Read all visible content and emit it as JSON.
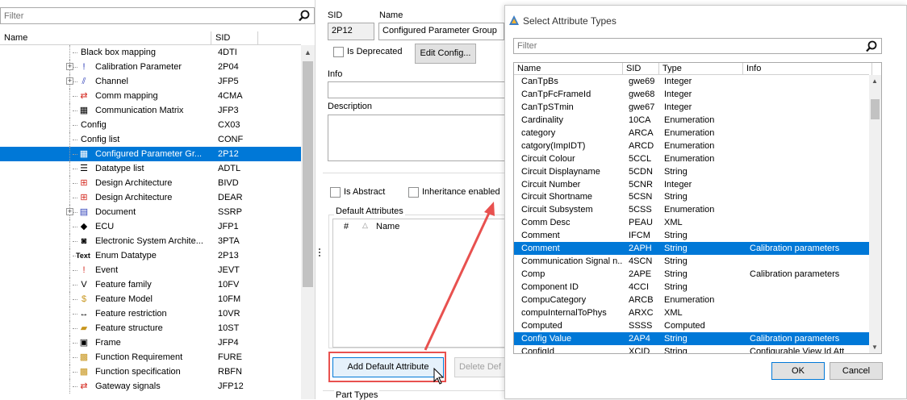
{
  "left_panel": {
    "filter_placeholder": "Filter",
    "columns": {
      "name": "Name",
      "sid": "SID"
    },
    "rows": [
      {
        "name": "Black box mapping",
        "sid": "4DTI",
        "icon": "dots-icon",
        "expand": false,
        "plain": true
      },
      {
        "name": "Calibration Parameter",
        "sid": "2P04",
        "icon": "exclamation-blue-icon",
        "expand": true
      },
      {
        "name": "Channel",
        "sid": "JFP5",
        "icon": "channel-icon",
        "expand": true
      },
      {
        "name": "Comm mapping",
        "sid": "4CMA",
        "icon": "red-arrows-icon",
        "expand": false
      },
      {
        "name": "Communication Matrix",
        "sid": "JFP3",
        "icon": "matrix-icon",
        "expand": false
      },
      {
        "name": "Config",
        "sid": "CX03",
        "icon": "none",
        "expand": false,
        "plain": true
      },
      {
        "name": "Config list",
        "sid": "CONF",
        "icon": "none",
        "expand": false,
        "plain": true
      },
      {
        "name": "Configured Parameter Gr...",
        "sid": "2P12",
        "icon": "parameter-group-icon",
        "expand": false,
        "selected": true
      },
      {
        "name": "Datatype list",
        "sid": "ADTL",
        "icon": "datatype-list-icon",
        "expand": false
      },
      {
        "name": "Design Architecture",
        "sid": "BIVD",
        "icon": "design-architecture-icon",
        "expand": false
      },
      {
        "name": "Design Architecture",
        "sid": "DEAR",
        "icon": "design-architecture-2-icon",
        "expand": false
      },
      {
        "name": "Document",
        "sid": "SSRP",
        "icon": "document-icon",
        "expand": true
      },
      {
        "name": "ECU",
        "sid": "JFP1",
        "icon": "ecu-icon",
        "expand": false
      },
      {
        "name": "Electronic System Archite...",
        "sid": "3PTA",
        "icon": "camera-icon",
        "expand": false
      },
      {
        "name": "Enum Datatype",
        "sid": "2P13",
        "icon": "text-icon",
        "expand": false
      },
      {
        "name": "Event",
        "sid": "JEVT",
        "icon": "exclamation-red-icon",
        "expand": false
      },
      {
        "name": "Feature family",
        "sid": "10FV",
        "icon": "feature-family-icon",
        "expand": false
      },
      {
        "name": "Feature Model",
        "sid": "10FM",
        "icon": "feature-model-icon",
        "expand": false
      },
      {
        "name": "Feature restriction",
        "sid": "10VR",
        "icon": "double-arrow-icon",
        "expand": false
      },
      {
        "name": "Feature structure",
        "sid": "10ST",
        "icon": "folder-open-icon",
        "expand": false
      },
      {
        "name": "Frame",
        "sid": "JFP4",
        "icon": "frame-icon",
        "expand": false
      },
      {
        "name": "Function Requirement",
        "sid": "FURE",
        "icon": "package-icon",
        "expand": false
      },
      {
        "name": "Function specification",
        "sid": "RBFN",
        "icon": "package-2-icon",
        "expand": false
      },
      {
        "name": "Gateway signals",
        "sid": "JFP12",
        "icon": "red-arrows-2-icon",
        "expand": false
      }
    ],
    "icon_glyphs": {
      "dots-icon": "",
      "exclamation-blue-icon": "!",
      "channel-icon": "⫽",
      "red-arrows-icon": "⇄",
      "matrix-icon": "▦",
      "none": "",
      "parameter-group-icon": "▦",
      "datatype-list-icon": "☰",
      "design-architecture-icon": "⊞",
      "design-architecture-2-icon": "⊞",
      "document-icon": "▤",
      "ecu-icon": "◆",
      "camera-icon": "◙",
      "text-icon": "Text",
      "exclamation-red-icon": "!",
      "feature-family-icon": "V",
      "feature-model-icon": "$",
      "double-arrow-icon": "↔",
      "folder-open-icon": "▰",
      "frame-icon": "▣",
      "package-icon": "▩",
      "package-2-icon": "▩",
      "red-arrows-2-icon": "⇄"
    }
  },
  "details": {
    "sid_label": "SID",
    "name_label": "Name",
    "sid_value": "2P12",
    "name_value": "Configured Parameter Group",
    "is_deprecated": "Is Deprecated",
    "edit_config": "Edit Config...",
    "info_label": "Info",
    "description_label": "Description",
    "is_abstract": "Is Abstract",
    "inheritance_enabled": "Inheritance enabled",
    "default_attributes": "Default Attributes",
    "attr_col_num": "#",
    "attr_col_name": "Name",
    "add_default_attribute": "Add Default Attribute",
    "delete_default": "Delete Def",
    "part_types": "Part Types"
  },
  "dialog": {
    "title": "Select Attribute Types",
    "filter_placeholder": "Filter",
    "columns": {
      "name": "Name",
      "sid": "SID",
      "type": "Type",
      "info": "Info"
    },
    "rows": [
      {
        "name": "CanTpBs",
        "sid": "gwe69",
        "type": "Integer",
        "info": ""
      },
      {
        "name": "CanTpFcFrameId",
        "sid": "gwe68",
        "type": "Integer",
        "info": ""
      },
      {
        "name": "CanTpSTmin",
        "sid": "gwe67",
        "type": "Integer",
        "info": ""
      },
      {
        "name": "Cardinality",
        "sid": "10CA",
        "type": "Enumeration",
        "info": ""
      },
      {
        "name": "category",
        "sid": "ARCA",
        "type": "Enumeration",
        "info": ""
      },
      {
        "name": "catgory(ImpIDT)",
        "sid": "ARCD",
        "type": "Enumeration",
        "info": ""
      },
      {
        "name": "Circuit Colour",
        "sid": "5CCL",
        "type": "Enumeration",
        "info": ""
      },
      {
        "name": "Circuit Displayname",
        "sid": "5CDN",
        "type": "String",
        "info": ""
      },
      {
        "name": "Circuit Number",
        "sid": "5CNR",
        "type": "Integer",
        "info": ""
      },
      {
        "name": "Circuit Shortname",
        "sid": "5CSN",
        "type": "String",
        "info": ""
      },
      {
        "name": "Circuit Subsystem",
        "sid": "5CSS",
        "type": "Enumeration",
        "info": ""
      },
      {
        "name": "Comm Desc",
        "sid": "PEAU",
        "type": "XML",
        "info": ""
      },
      {
        "name": "Comment",
        "sid": "IFCM",
        "type": "String",
        "info": ""
      },
      {
        "name": "Comment",
        "sid": "2APH",
        "type": "String",
        "info": "Calibration parameters",
        "selected": true
      },
      {
        "name": "Communication Signal n...",
        "sid": "4SCN",
        "type": "String",
        "info": ""
      },
      {
        "name": "Comp",
        "sid": "2APE",
        "type": "String",
        "info": "Calibration parameters"
      },
      {
        "name": "Component ID",
        "sid": "4CCI",
        "type": "String",
        "info": ""
      },
      {
        "name": "CompuCategory",
        "sid": "ARCB",
        "type": "Enumeration",
        "info": ""
      },
      {
        "name": "compuInternalToPhys",
        "sid": "ARXC",
        "type": "XML",
        "info": ""
      },
      {
        "name": "Computed",
        "sid": "SSSS",
        "type": "Computed",
        "info": ""
      },
      {
        "name": "Config Value",
        "sid": "2AP4",
        "type": "String",
        "info": "Calibration parameters",
        "selected": true
      },
      {
        "name": "ConfigId",
        "sid": "XCID",
        "type": "String",
        "info": "Configurable View Id Att"
      }
    ],
    "ok": "OK",
    "cancel": "Cancel"
  },
  "colors": {
    "selection": "#0078d7",
    "annotation": "#e8514f"
  }
}
